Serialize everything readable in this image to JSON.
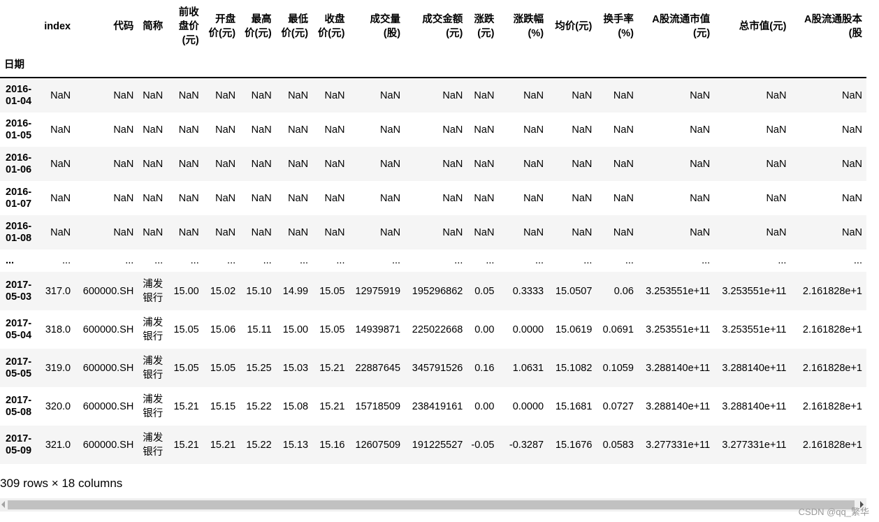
{
  "table": {
    "index_name": "日期",
    "columns": [
      "index",
      "代码",
      "简称",
      "前收盘价(元)",
      "开盘价(元)",
      "最高价(元)",
      "最低价(元)",
      "收盘价(元)",
      "成交量(股)",
      "成交金额(元)",
      "涨跌(元)",
      "涨跌幅(%)",
      "均价(元)",
      "换手率(%)",
      "A股流通市值(元)",
      "总市值(元)",
      "A股流通股本(股"
    ],
    "nan_rows": [
      {
        "date": "2016-01-04",
        "values": [
          "NaN",
          "NaN",
          "NaN",
          "NaN",
          "NaN",
          "NaN",
          "NaN",
          "NaN",
          "NaN",
          "NaN",
          "NaN",
          "NaN",
          "NaN",
          "NaN",
          "NaN",
          "NaN",
          "NaN"
        ]
      },
      {
        "date": "2016-01-05",
        "values": [
          "NaN",
          "NaN",
          "NaN",
          "NaN",
          "NaN",
          "NaN",
          "NaN",
          "NaN",
          "NaN",
          "NaN",
          "NaN",
          "NaN",
          "NaN",
          "NaN",
          "NaN",
          "NaN",
          "NaN"
        ]
      },
      {
        "date": "2016-01-06",
        "values": [
          "NaN",
          "NaN",
          "NaN",
          "NaN",
          "NaN",
          "NaN",
          "NaN",
          "NaN",
          "NaN",
          "NaN",
          "NaN",
          "NaN",
          "NaN",
          "NaN",
          "NaN",
          "NaN",
          "NaN"
        ]
      },
      {
        "date": "2016-01-07",
        "values": [
          "NaN",
          "NaN",
          "NaN",
          "NaN",
          "NaN",
          "NaN",
          "NaN",
          "NaN",
          "NaN",
          "NaN",
          "NaN",
          "NaN",
          "NaN",
          "NaN",
          "NaN",
          "NaN",
          "NaN"
        ]
      },
      {
        "date": "2016-01-08",
        "values": [
          "NaN",
          "NaN",
          "NaN",
          "NaN",
          "NaN",
          "NaN",
          "NaN",
          "NaN",
          "NaN",
          "NaN",
          "NaN",
          "NaN",
          "NaN",
          "NaN",
          "NaN",
          "NaN",
          "NaN"
        ]
      }
    ],
    "ellipsis": "...",
    "data_rows": [
      {
        "date": "2017-05-03",
        "values": [
          "317.0",
          "600000.SH",
          "浦发银行",
          "15.00",
          "15.02",
          "15.10",
          "14.99",
          "15.05",
          "12975919",
          "195296862",
          "0.05",
          "0.3333",
          "15.0507",
          "0.06",
          "3.253551e+11",
          "3.253551e+11",
          "2.161828e+1"
        ]
      },
      {
        "date": "2017-05-04",
        "values": [
          "318.0",
          "600000.SH",
          "浦发银行",
          "15.05",
          "15.06",
          "15.11",
          "15.00",
          "15.05",
          "14939871",
          "225022668",
          "0.00",
          "0.0000",
          "15.0619",
          "0.0691",
          "3.253551e+11",
          "3.253551e+11",
          "2.161828e+1"
        ]
      },
      {
        "date": "2017-05-05",
        "values": [
          "319.0",
          "600000.SH",
          "浦发银行",
          "15.05",
          "15.05",
          "15.25",
          "15.03",
          "15.21",
          "22887645",
          "345791526",
          "0.16",
          "1.0631",
          "15.1082",
          "0.1059",
          "3.288140e+11",
          "3.288140e+11",
          "2.161828e+1"
        ]
      },
      {
        "date": "2017-05-08",
        "values": [
          "320.0",
          "600000.SH",
          "浦发银行",
          "15.21",
          "15.15",
          "15.22",
          "15.08",
          "15.21",
          "15718509",
          "238419161",
          "0.00",
          "0.0000",
          "15.1681",
          "0.0727",
          "3.288140e+11",
          "3.288140e+11",
          "2.161828e+1"
        ]
      },
      {
        "date": "2017-05-09",
        "values": [
          "321.0",
          "600000.SH",
          "浦发银行",
          "15.21",
          "15.21",
          "15.22",
          "15.13",
          "15.16",
          "12607509",
          "191225527",
          "-0.05",
          "-0.3287",
          "15.1676",
          "0.0583",
          "3.277331e+11",
          "3.277331e+11",
          "2.161828e+1"
        ]
      }
    ]
  },
  "shape_text": "309 rows × 18 columns",
  "watermark": "CSDN @qq_繁华"
}
